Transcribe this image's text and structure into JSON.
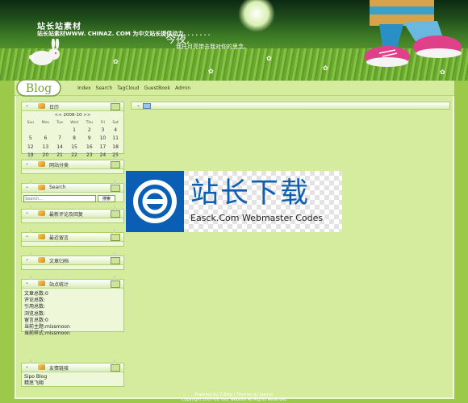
{
  "header": {
    "site_title": "站长站素材",
    "site_desc": "站长站素材WWW. CHINAZ. COM 为中文站长提供动力. . . . . . .",
    "poem_line1": "今夜,",
    "poem_line2": "我托月亮带去我对你的思念。"
  },
  "logo_text": "Blog",
  "nav": [
    "Index",
    "Search",
    "TagCloud",
    "GuestBook",
    "Admin"
  ],
  "sidebar": {
    "calendar": {
      "title": "日历",
      "month": "<< 2008-10 >>",
      "weekdays": [
        "Sun",
        "Mon",
        "Tue",
        "Wed",
        "Thu",
        "Fri",
        "Sat"
      ],
      "weeks": [
        [
          "",
          "",
          "",
          "1",
          "2",
          "3",
          "4"
        ],
        [
          "5",
          "6",
          "7",
          "8",
          "9",
          "10",
          "11"
        ],
        [
          "12",
          "13",
          "14",
          "15",
          "16",
          "17",
          "18"
        ],
        [
          "19",
          "20",
          "21",
          "22",
          "23",
          "24",
          "25"
        ],
        [
          "26",
          "27",
          "28",
          "29",
          "30",
          "31",
          ""
        ]
      ]
    },
    "categories_title": "网站分类",
    "search": {
      "title": "Search",
      "placeholder": "Search...",
      "button": "搜索"
    },
    "recent_comments_title": "最新评论及回复",
    "recent_messages_title": "最近留言",
    "archive_title": "文章归档",
    "stats": {
      "title": "站点统计",
      "lines": [
        "文章总数:0",
        "评论总数:",
        "引用总数:",
        "浏览总数:",
        "留言总数:0",
        "当前主题:missmoon",
        "当前样式:missmoon"
      ]
    },
    "links": {
      "title": "友情链接",
      "items": [
        "Sipo Blog",
        "精思飞翔"
      ]
    }
  },
  "watermark": {
    "title": "站长下载",
    "subtitle": "Easck.Com Webmaster Codes"
  },
  "footer": {
    "line1": "Powered by Z-Blog | Themes by Jasmin",
    "line2": "Copyright 2007-08 Your website All Rights Reserved"
  },
  "colors": {
    "page_bg": "#9cc94a",
    "frame_bg": "#d5ec9e",
    "panel_bg": "#eef7d8",
    "watermark_blue": "#0a5fb4"
  }
}
